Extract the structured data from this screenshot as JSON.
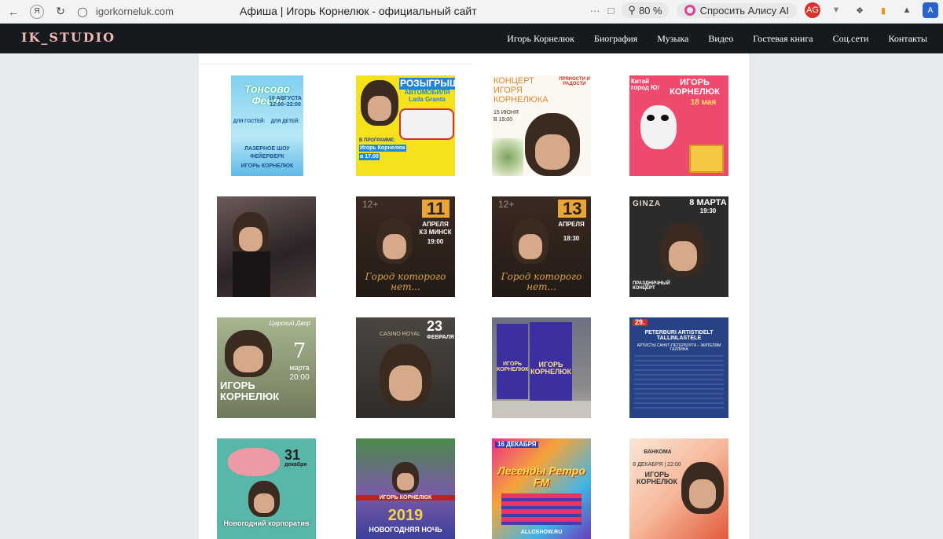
{
  "browser": {
    "url": "igorkorneluk.com",
    "title": "Афиша | Игорь Корнелюк - официальный сайт",
    "zoom": "80 %",
    "alice_label": "Спросить Алису AI",
    "ext_badge": "AG"
  },
  "site": {
    "logo": "IK_STUDIO",
    "nav": [
      "Игорь Корнелюк",
      "Биография",
      "Музыка",
      "Видео",
      "Гостевая книга",
      "Соц.сети",
      "Контакты"
    ]
  },
  "posters": [
    {
      "lines": [
        "Тонсово Фест",
        "10 АВГУСТА",
        "12:00–22:00",
        "ДЛЯ ГОСТЕЙ:",
        "ДЛЯ ДЕТЕЙ:",
        "ЛАЗЕРНОЕ ШОУ",
        "ФЕЙЕРВЕРК",
        "ИГОРЬ КОРНЕЛЮК"
      ]
    },
    {
      "lines": [
        "РОЗЫГРЫШ",
        "АВТОМОБИЛЯ",
        "Lada Granta",
        "В ПРОГРАММЕ:",
        "Игорь Корнелюк",
        "в 17.00"
      ]
    },
    {
      "lines": [
        "КОНЦЕРТ",
        "ИГОРЯ",
        "КОРНЕЛЮКА",
        "15 ИЮНЯ",
        "В 19:00",
        "ПРЯНОСТИ И РАДОСТИ"
      ]
    },
    {
      "lines": [
        "Китай город Юг",
        "ИГОРЬ КОРНЕЛЮК",
        "18 мая"
      ]
    },
    {
      "lines": []
    },
    {
      "lines": [
        "12+",
        "11",
        "АПРЕЛЯ",
        "КЗ МИНСК",
        "19:00",
        "Город которого нет..."
      ]
    },
    {
      "lines": [
        "12+",
        "13",
        "АПРЕЛЯ",
        "18:30",
        "Город которого нет..."
      ]
    },
    {
      "lines": [
        "GINZA",
        "8 МАРТА",
        "19:30",
        "ПРАЗДНИЧНЫЙ КОНЦЕРТ"
      ]
    },
    {
      "lines": [
        "Царский Двор",
        "7",
        "марта",
        "20:00",
        "ИГОРЬ КОРНЕЛЮК"
      ]
    },
    {
      "lines": [
        "CASINO ROYAL",
        "23",
        "ФЕВРАЛЯ"
      ]
    },
    {
      "lines": [
        "ИГОРЬ КОРНЕЛЮК",
        "ИГОРЬ КОРНЕЛЮК"
      ]
    },
    {
      "lines": [
        "29.",
        "PETERBURI ARTISTIDELT TALLINLASTELE",
        "АРТИСТЫ САНКТ-ПЕТЕРБУРГА – ЖИТЕЛЯМ ТАЛЛИНА"
      ]
    },
    {
      "lines": [
        "31",
        "декабря",
        "Новогодний корпоратив"
      ]
    },
    {
      "lines": [
        "ИГОРЬ КОРНЕЛЮК",
        "2019",
        "НОВОГОДНЯЯ НОЧЬ"
      ]
    },
    {
      "lines": [
        "16 ДЕКАБРЯ",
        "Легенды Ретро FM",
        "ALLOSHOW.RU"
      ]
    },
    {
      "lines": [
        "ВАНКОМА",
        "8 ДЕКАБРЯ | 22:00",
        "ИГОРЬ КОРНЕЛЮК"
      ]
    }
  ],
  "colors": {
    "header_bg": "#161a1d",
    "logo": "#f2b8b8",
    "page_bg": "#e8ebee"
  }
}
